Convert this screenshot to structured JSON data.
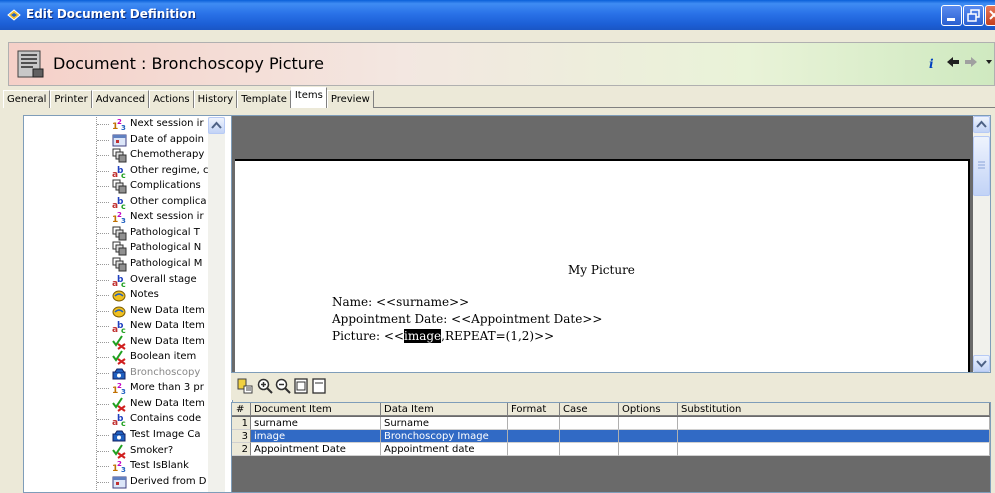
{
  "window": {
    "title": "Edit Document Definition"
  },
  "header": {
    "title": "Document : Bronchoscopy Picture",
    "info_glyph": "i"
  },
  "tabs": [
    {
      "label": "General",
      "active": false
    },
    {
      "label": "Printer",
      "active": false
    },
    {
      "label": "Advanced",
      "active": false
    },
    {
      "label": "Actions",
      "active": false
    },
    {
      "label": "History",
      "active": false
    },
    {
      "label": "Template",
      "active": false
    },
    {
      "label": "Items",
      "active": true
    },
    {
      "label": "Preview",
      "active": false
    }
  ],
  "tree": {
    "items": [
      {
        "label": "Next session ir",
        "icon": "numeric-icon"
      },
      {
        "label": "Date of appoin",
        "icon": "date-icon"
      },
      {
        "label": "Chemotherapy",
        "icon": "category-icon"
      },
      {
        "label": "Other regime, c",
        "icon": "text-icon"
      },
      {
        "label": "Complications",
        "icon": "category-icon"
      },
      {
        "label": "Other complica",
        "icon": "text-icon"
      },
      {
        "label": "Next session ir",
        "icon": "numeric-icon"
      },
      {
        "label": "Pathological T",
        "icon": "category-icon"
      },
      {
        "label": "Pathological N",
        "icon": "category-icon"
      },
      {
        "label": "Pathological M",
        "icon": "category-icon"
      },
      {
        "label": "Overall stage",
        "icon": "text-icon"
      },
      {
        "label": "Notes",
        "icon": "notes-icon"
      },
      {
        "label": "New Data Item",
        "icon": "notes-icon"
      },
      {
        "label": "New Data Item",
        "icon": "text-icon"
      },
      {
        "label": "New Data Item",
        "icon": "boolean-icon"
      },
      {
        "label": "Boolean item",
        "icon": "boolean-icon"
      },
      {
        "label": "Bronchoscopy",
        "icon": "image-icon",
        "selected": true
      },
      {
        "label": "More than 3 pr",
        "icon": "numeric-icon"
      },
      {
        "label": "New Data Item",
        "icon": "boolean-icon"
      },
      {
        "label": "Contains code",
        "icon": "text-icon"
      },
      {
        "label": "Test Image Ca",
        "icon": "image-icon"
      },
      {
        "label": "Smoker?",
        "icon": "boolean-icon"
      },
      {
        "label": "Test IsBlank",
        "icon": "numeric-icon"
      },
      {
        "label": "Derived from D",
        "icon": "date-icon"
      }
    ]
  },
  "preview": {
    "heading": "My Picture",
    "line1": "Name: <<surname>>",
    "line2": "Appointment Date: <<Appointment Date>>",
    "line3_prefix": "Picture: <<",
    "line3_highlight": "image",
    "line3_suffix": ",REPEAT=(1,2)>>"
  },
  "zoombar": {
    "buttons": [
      "fields-icon",
      "zoom-in-icon",
      "zoom-out-icon",
      "fit-page-icon",
      "actual-size-icon"
    ]
  },
  "grid": {
    "columns": [
      "#",
      "Document Item",
      "Data Item",
      "Format",
      "Case",
      "Options",
      "Substitution"
    ],
    "rows": [
      {
        "num": "1",
        "doc_item": "surname",
        "data_item": "Surname",
        "format": "",
        "case": "",
        "options": "",
        "substitution": ""
      },
      {
        "num": "3",
        "doc_item": "image",
        "data_item": "Bronchoscopy Image",
        "format": "",
        "case": "",
        "options": "",
        "substitution": "",
        "selected": true
      },
      {
        "num": "2",
        "doc_item": "Appointment Date",
        "data_item": "Appointment date",
        "format": "",
        "case": "",
        "options": "",
        "substitution": ""
      }
    ]
  },
  "colors": {
    "titlebar": "#2a72e8",
    "selection": "#316ac5",
    "preview_bg": "#6a6a6a"
  }
}
